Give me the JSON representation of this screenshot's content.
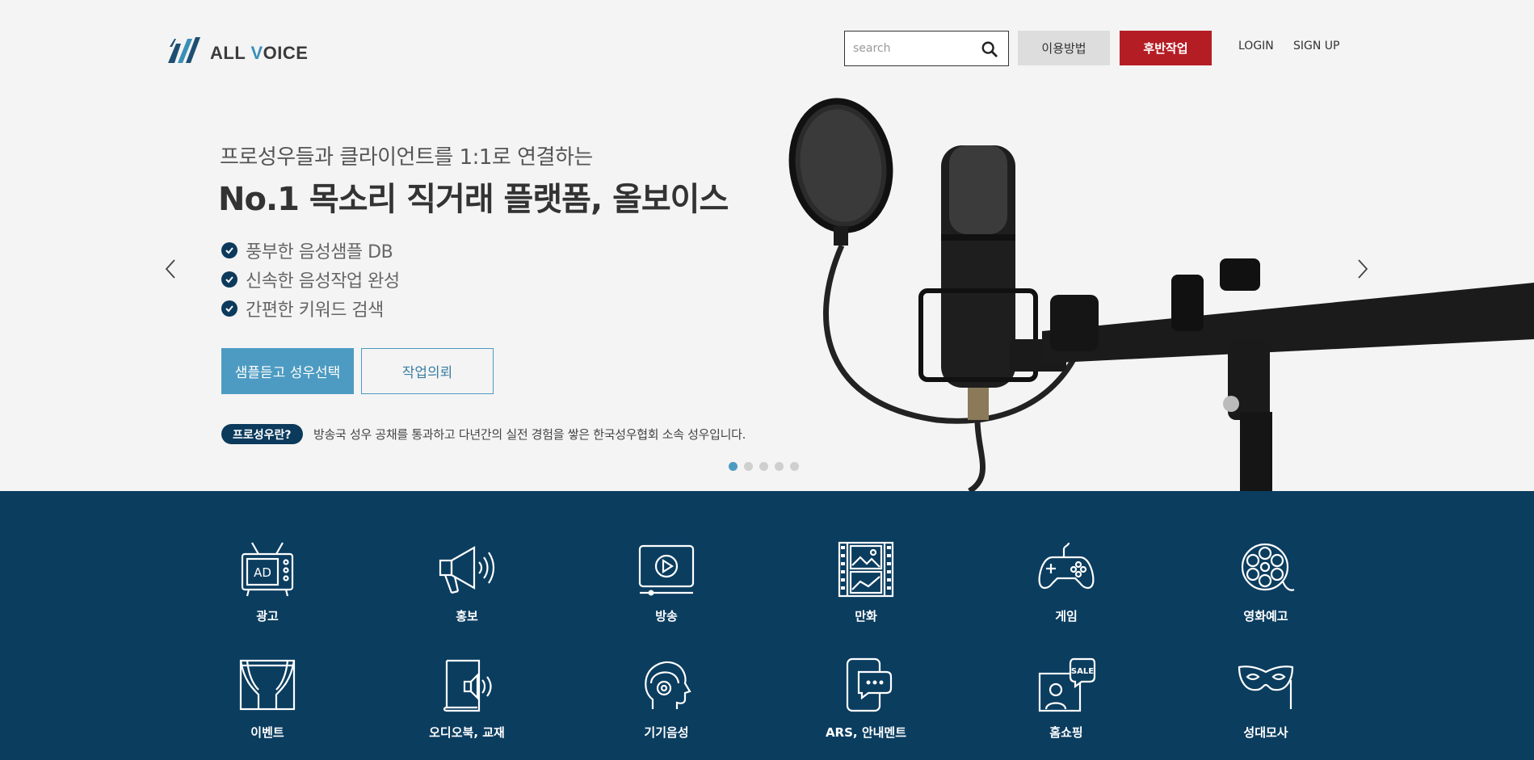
{
  "header": {
    "logo_text_pre": "ALL ",
    "logo_text_v": "V",
    "logo_text_post": "OICE",
    "search_placeholder": "search",
    "howto_label": "이용방법",
    "request_label": "후반작업",
    "login_label": "LOGIN",
    "signup_label": "SIGN UP"
  },
  "hero": {
    "subtitle": "프로성우들과 클라이언트를 1:1로 연결하는",
    "title": "No.1 목소리 직거래 플랫폼, 올보이스",
    "features": [
      "풍부한 음성샘플 DB",
      "신속한 음성작업 완성",
      "간편한 키워드 검색"
    ],
    "primary_button": "샘플듣고 성우선택",
    "secondary_button": "작업의뢰",
    "badge": "프로성우란?",
    "badge_desc": "방송국 성우 공채를 통과하고 다년간의 실전 경험을 쌓은 한국성우협회 소속 성우입니다.",
    "slide_count": 5,
    "active_slide": 1
  },
  "colors": {
    "navy": "#0b3d5f",
    "accent_blue": "#4d9bc2",
    "brand_red": "#b51d24"
  },
  "categories": [
    {
      "label": "광고",
      "icon": "tv-ad-icon"
    },
    {
      "label": "홍보",
      "icon": "megaphone-icon"
    },
    {
      "label": "방송",
      "icon": "video-play-icon"
    },
    {
      "label": "만화",
      "icon": "film-strip-icon"
    },
    {
      "label": "게임",
      "icon": "gamepad-icon"
    },
    {
      "label": "영화예고",
      "icon": "film-reel-icon"
    },
    {
      "label": "이벤트",
      "icon": "stage-curtain-icon"
    },
    {
      "label": "오디오북, 교재",
      "icon": "audiobook-icon"
    },
    {
      "label": "기기음성",
      "icon": "head-headphones-icon"
    },
    {
      "label": "ARS, 안내멘트",
      "icon": "phone-chat-icon"
    },
    {
      "label": "홈쇼핑",
      "icon": "sale-presenter-icon"
    },
    {
      "label": "성대모사",
      "icon": "mask-icon"
    }
  ]
}
